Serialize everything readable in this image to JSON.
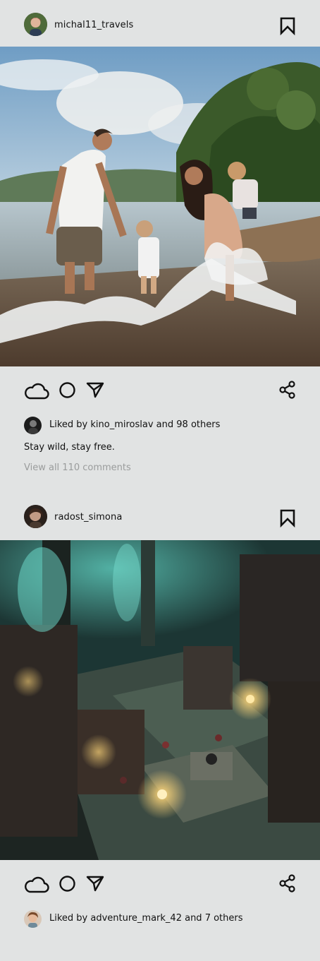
{
  "posts": [
    {
      "username": "michal11_travels",
      "liked_by_user": "kino_miroslav",
      "likes_text": "Liked by kino_miroslav and 98 others",
      "caption": "Stay wild, stay free.",
      "comments_link": "View all 110 comments",
      "icons": [
        "bookmark-icon",
        "cloud-like-icon",
        "comment-icon",
        "send-icon",
        "share-icon"
      ]
    },
    {
      "username": "radost_simona",
      "liked_by_user": "adventure_mark_42",
      "likes_text": "Liked by adventure_mark_42 and 7 others",
      "icons": [
        "bookmark-icon",
        "cloud-like-icon",
        "comment-icon",
        "send-icon",
        "share-icon"
      ]
    }
  ],
  "colors": {
    "background": "#e1e3e3",
    "muted_text": "#9a9c9c",
    "icon": "#111111"
  }
}
